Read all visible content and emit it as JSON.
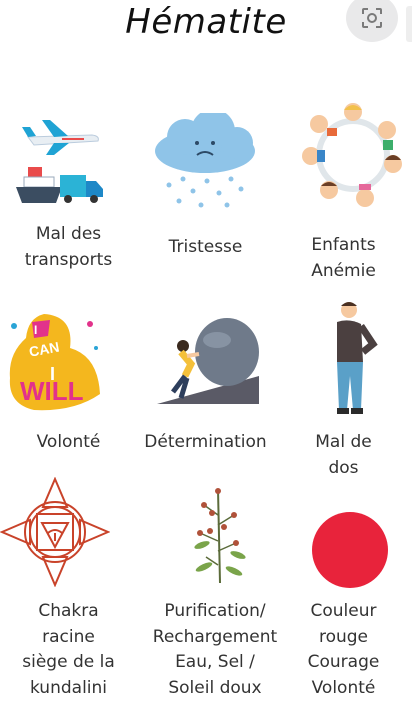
{
  "title": "Hématite",
  "header": {
    "icon": "lens-search-icon"
  },
  "items": [
    {
      "name": "travel-sickness",
      "icon": "transport-icon",
      "lines": [
        "Mal des",
        "transports"
      ]
    },
    {
      "name": "sadness",
      "icon": "rain-cloud-icon",
      "lines": [
        "Tristesse"
      ]
    },
    {
      "name": "children-anemia",
      "icon": "children-circle-icon",
      "lines": [
        "Enfants",
        "Anémie"
      ]
    },
    {
      "name": "willpower",
      "icon": "i-will-icon",
      "lines": [
        "Volonté"
      ]
    },
    {
      "name": "determination",
      "icon": "push-boulder-icon",
      "lines": [
        "Détermination"
      ]
    },
    {
      "name": "back-pain",
      "icon": "back-pain-man-icon",
      "lines": [
        "Mal de",
        "dos"
      ]
    },
    {
      "name": "root-chakra",
      "icon": "root-chakra-icon",
      "lines": [
        "Chakra",
        "racine",
        "siège de la",
        "kundalini"
      ]
    },
    {
      "name": "purification",
      "icon": "herb-icon",
      "lines": [
        "Purification/",
        "Rechargement",
        "Eau, Sel /",
        "Soleil doux"
      ]
    },
    {
      "name": "color",
      "icon": "red-circle-icon",
      "lines": [
        "Couleur",
        "rouge",
        "Courage",
        "Volonté"
      ]
    }
  ],
  "colors": {
    "chakra": "#c9432a",
    "dot": "#e8233b",
    "cloud": "#8fc4e8"
  }
}
